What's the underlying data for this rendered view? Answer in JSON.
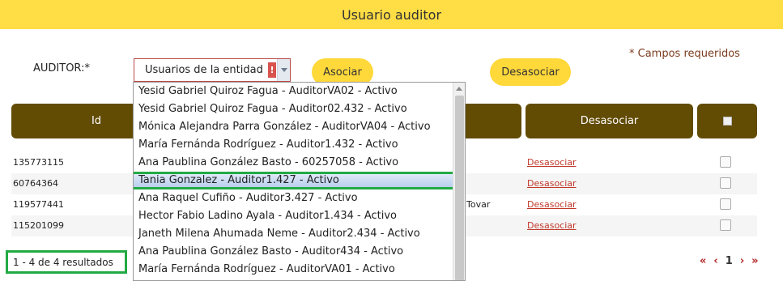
{
  "header": {
    "title": "Usuario auditor"
  },
  "form": {
    "required_note": "* Campos requeridos",
    "auditor_label": "AUDITOR:*",
    "select_value": "Usuarios de la entidad",
    "warn_glyph": "!",
    "asociar_label": "Asociar",
    "desasociar_label": "Desasociar"
  },
  "table": {
    "columns": [
      "Id",
      "",
      "Desasociar",
      ""
    ],
    "rows": [
      {
        "id": "135773115",
        "name": "",
        "link": "Desasociar"
      },
      {
        "id": "60764364",
        "name": "",
        "link": "Desasociar"
      },
      {
        "id": "119577441",
        "name": "Tovar",
        "link": "Desasociar"
      },
      {
        "id": "115201099",
        "name": "",
        "link": "Desasociar"
      }
    ]
  },
  "results": {
    "text": "1 - 4 de 4 resultados"
  },
  "pager": {
    "first": "«",
    "prev": "‹",
    "page": "1",
    "next": "›",
    "last": "»"
  },
  "dropdown": {
    "options": [
      "Yesid Gabriel Quiroz Fagua - AuditorVA02 - Activo",
      "Yesid Gabriel Quiroz Fagua - Auditor02.432 - Activo",
      "Mónica Alejandra Parra González - AuditorVA04 - Activo",
      "María Fernánda Rodríguez - Auditor1.432 - Activo",
      "Ana Paublina González Basto - 60257058 - Activo",
      "Tania Gonzalez - Auditor1.427 - Activo",
      "Ana Raquel Cufiño - Auditor3.427 - Activo",
      "Hector Fabio Ladino Ayala - Auditor1.434 - Activo",
      "Janeth Milena Ahumada Neme - Auditor2.434 - Activo",
      "Ana Paublina González Basto - Auditor434 - Activo",
      "María Fernánda Rodríguez - AuditorVA01 - Activo"
    ],
    "selected_index": 5
  },
  "colors": {
    "accent": "#ffdd44",
    "table_header": "#624b03",
    "highlight": "#22aa44",
    "link": "#c0392b"
  }
}
